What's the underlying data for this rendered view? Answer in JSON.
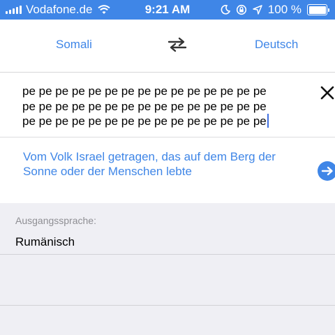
{
  "status_bar": {
    "carrier": "Vodafone.de",
    "time": "9:21 AM",
    "battery_percent": "100 %",
    "icons": [
      "signal-bars-icon",
      "wifi-icon",
      "moon-icon",
      "rotation-lock-icon",
      "location-arrow-icon",
      "battery-icon"
    ]
  },
  "language_bar": {
    "source_language": "Somali",
    "target_language": "Deutsch",
    "swap_icon": "swap-arrows-icon"
  },
  "input": {
    "text": "pe pe pe pe pe pe pe pe pe pe pe pe pe pe pe\npe pe pe pe pe pe pe pe pe pe pe pe pe pe pe\npe pe pe pe pe pe pe pe pe pe pe pe pe pe pe",
    "clear_icon": "close-icon"
  },
  "translation": {
    "text": "Vom Volk Israel getragen, das auf dem Berg der Sonne oder der Menschen lebte",
    "go_icon": "arrow-right-circle-icon"
  },
  "detected_language": {
    "label": "Ausgangssprache:",
    "value": "Rumänisch"
  },
  "colors": {
    "accent": "#3f86e7",
    "status_bar_bg": "#3f86e7",
    "panel_bg": "#efeff4",
    "caret": "#3f6fe0"
  }
}
